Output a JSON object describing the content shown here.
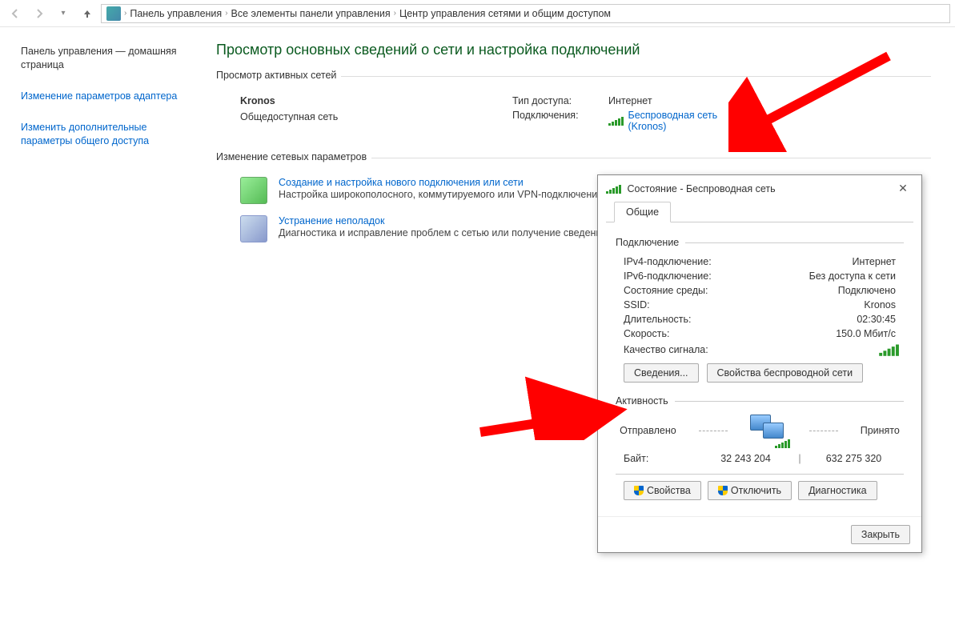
{
  "nav": {
    "crumb1": "Панель управления",
    "crumb2": "Все элементы панели управления",
    "crumb3": "Центр управления сетями и общим доступом"
  },
  "sidebar": {
    "home": "Панель управления — домашняя страница",
    "adapter": "Изменение параметров адаптера",
    "sharing": "Изменить дополнительные параметры общего доступа"
  },
  "content": {
    "title": "Просмотр основных сведений о сети и настройка подключений",
    "active_h": "Просмотр активных сетей",
    "net_name": "Kronos",
    "net_type": "Общедоступная сеть",
    "access_k": "Тип доступа:",
    "access_v": "Интернет",
    "conn_k": "Подключения:",
    "conn_v": "Беспроводная сеть (Kronos)",
    "change_h": "Изменение сетевых параметров",
    "item1_t": "Создание и настройка нового подключения или сети",
    "item1_d": "Настройка широкополосного, коммутируемого или VPN-подключения либо настройка маршрутизатора или точки доступа.",
    "item2_t": "Устранение неполадок",
    "item2_d": "Диагностика и исправление проблем с сетью или получение сведений об устранении неполадок."
  },
  "dialog": {
    "title": "Состояние - Беспроводная сеть",
    "tab": "Общие",
    "box1": "Подключение",
    "ipv4_k": "IPv4-подключение:",
    "ipv4_v": "Интернет",
    "ipv6_k": "IPv6-подключение:",
    "ipv6_v": "Без доступа к сети",
    "media_k": "Состояние среды:",
    "media_v": "Подключено",
    "ssid_k": "SSID:",
    "ssid_v": "Kronos",
    "dur_k": "Длительность:",
    "dur_v": "02:30:45",
    "speed_k": "Скорость:",
    "speed_v": "150.0 Мбит/с",
    "signal_k": "Качество сигнала:",
    "details_btn": "Сведения...",
    "wprops_btn": "Свойства беспроводной сети",
    "box2": "Активность",
    "sent_lbl": "Отправлено",
    "recv_lbl": "Принято",
    "bytes_lbl": "Байт:",
    "bytes_sent": "32 243 204",
    "bytes_recv": "632 275 320",
    "props_btn": "Свойства",
    "disable_btn": "Отключить",
    "diag_btn": "Диагностика",
    "close_btn": "Закрыть"
  }
}
